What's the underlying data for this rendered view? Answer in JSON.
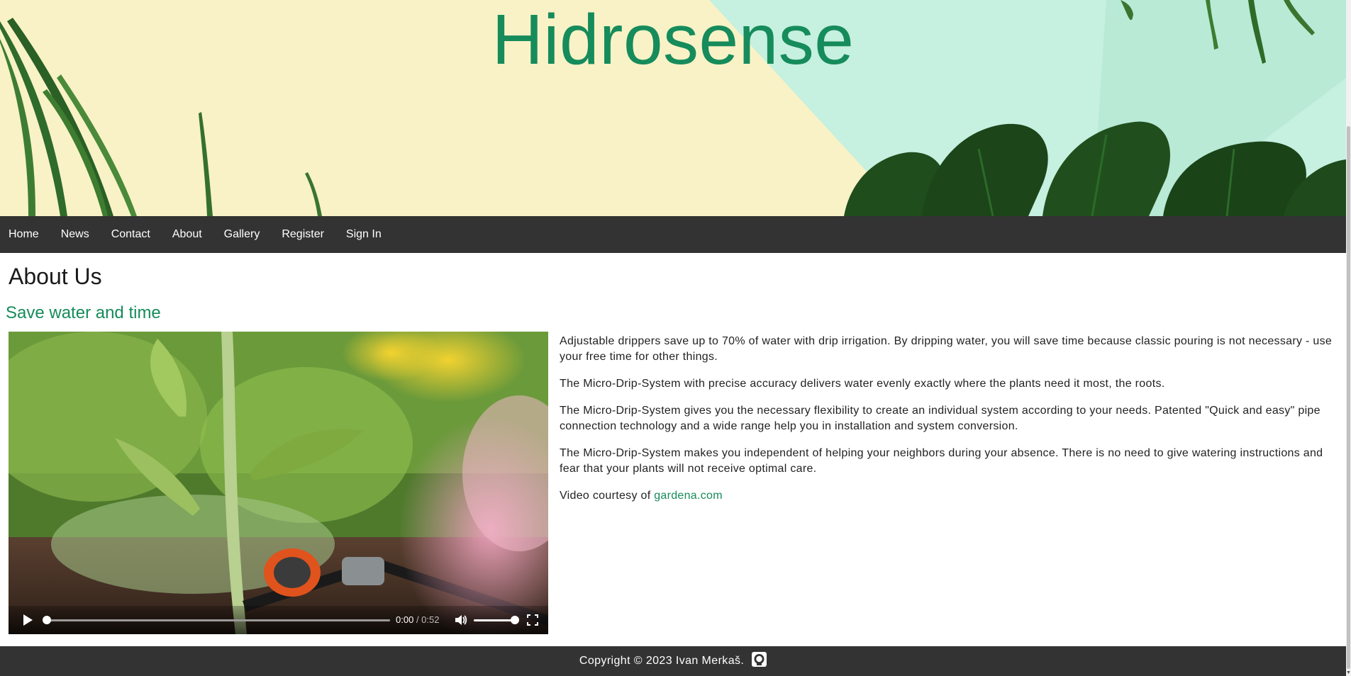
{
  "header": {
    "title": "Hidrosense"
  },
  "nav": {
    "items": [
      {
        "label": "Home"
      },
      {
        "label": "News"
      },
      {
        "label": "Contact"
      },
      {
        "label": "About"
      },
      {
        "label": "Gallery"
      },
      {
        "label": "Register"
      },
      {
        "label": "Sign In"
      }
    ]
  },
  "main": {
    "heading": "About Us",
    "subheading": "Save water and time",
    "paragraphs": [
      "Adjustable drippers save up to 70% of water with drip irrigation. By dripping water, you will save time because classic pouring is not necessary - use your free time for other things.",
      "The Micro-Drip-System with precise accuracy delivers water evenly exactly where the plants need it most, the roots.",
      "The Micro-Drip-System gives you the necessary flexibility to create an individual system according to your needs. Patented \"Quick and easy\" pipe connection technology and a wide range help you in installation and system conversion.",
      "The Micro-Drip-System makes you independent of helping your neighbors during your absence. There is no need to give watering instructions and fear that your plants will not receive optimal care."
    ],
    "credit_prefix": "Video courtesy of ",
    "credit_link": "gardena.com"
  },
  "video": {
    "current_time": "0:00",
    "duration": "/ 0:52",
    "progress": 0.0,
    "volume": 1.0,
    "icons": {
      "play": "play-icon",
      "volume": "volume-icon",
      "fullscreen": "fullscreen-icon"
    }
  },
  "footer": {
    "copyright": "Copyright © 2023 Ivan Merkaš.",
    "icon": "github-icon"
  },
  "colors": {
    "brand_green": "#168b5b",
    "nav_bg": "#333333",
    "banner_cream": "#f8f2c6",
    "banner_mint": "#c6f0e0"
  }
}
